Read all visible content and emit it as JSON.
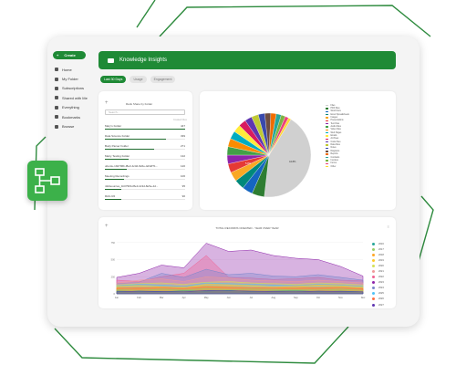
{
  "sidebar": {
    "create_label": "Create",
    "items": [
      {
        "label": "Home",
        "icon": "home-icon"
      },
      {
        "label": "My Folder",
        "icon": "folder-icon"
      },
      {
        "label": "Subscriptions",
        "icon": "bell-icon"
      },
      {
        "label": "Shared with Me",
        "icon": "share-icon"
      },
      {
        "label": "Everything",
        "icon": "layers-icon"
      },
      {
        "label": "Bookmarks",
        "icon": "bookmark-icon"
      },
      {
        "label": "Browse",
        "icon": "browse-icon"
      }
    ]
  },
  "header": {
    "title": "Knowledge Insights"
  },
  "tabs": [
    {
      "label": "Last 30 Days",
      "active": true
    },
    {
      "label": "Usage",
      "active": false
    },
    {
      "label": "Engagement",
      "active": false
    }
  ],
  "folders_card": {
    "title": "Rank Share by Folder",
    "search_placeholder": "Search...",
    "column_label": "Created Files",
    "rows": [
      {
        "name": "Mary's Folder",
        "count": "447",
        "fraction": 1.0
      },
      {
        "name": "Data Science Folder",
        "count": "339",
        "fraction": 0.76
      },
      {
        "name": "Body Parser Folder",
        "count": "271",
        "fraction": 0.61
      },
      {
        "name": "Marty Testing Folder",
        "count": "132",
        "fraction": 0.3
      },
      {
        "name": "ubuntu-1b0796b-f8e3-4c3d-8e5e-4d32f71...",
        "count": "120",
        "fraction": 0.27
      },
      {
        "name": "Meeting Recordings",
        "count": "106",
        "fraction": 0.24
      },
      {
        "name": "ntkbsources_1b0796b-f8e3-4c3d-8e5e-4d...",
        "count": "95",
        "fraction": 0.21
      },
      {
        "name": "RAG R2",
        "count": "90",
        "fraction": 0.2
      }
    ]
  },
  "pie_card": {
    "slice_labels": [
      "44.8%",
      "5.0%"
    ],
    "legend": [
      {
        "label": "Files",
        "color": "#d0d0d0"
      },
      {
        "label": "PDF Files",
        "color": "#2e7d32"
      },
      {
        "label": "Word Docs",
        "color": "#1565c0"
      },
      {
        "label": "Excel Spreadsheets",
        "color": "#00897b"
      },
      {
        "label": "Images",
        "color": "#f9a825"
      },
      {
        "label": "Presentations",
        "color": "#e53935"
      },
      {
        "label": "Text Files",
        "color": "#8e24aa"
      },
      {
        "label": "Audio Files",
        "color": "#43a047"
      },
      {
        "label": "Video Files",
        "color": "#fb8c00"
      },
      {
        "label": "Web Pages",
        "color": "#00acc1"
      },
      {
        "label": "Emails",
        "color": "#ffeb3b"
      },
      {
        "label": "Archives",
        "color": "#d81b60"
      },
      {
        "label": "Code Files",
        "color": "#5e35b1"
      },
      {
        "label": "Data Files",
        "color": "#c0ca33"
      },
      {
        "label": "Notes",
        "color": "#3949ab"
      },
      {
        "label": "Diagrams",
        "color": "#6d4c41"
      },
      {
        "label": "Reports",
        "color": "#ef6c00"
      },
      {
        "label": "Contracts",
        "color": "#26a69a"
      },
      {
        "label": "Invoices",
        "color": "#7cb342"
      },
      {
        "label": "Forms",
        "color": "#ec407a"
      },
      {
        "label": "Other",
        "color": "#fdd835"
      }
    ]
  },
  "chart_data": [
    {
      "type": "pie",
      "values": [
        44.8,
        5.0,
        4.2,
        4.0,
        3.8,
        3.6,
        3.5,
        3.4,
        3.3,
        3.2,
        3.1,
        3.0,
        2.9,
        2.8,
        2.6,
        2.4,
        2.2,
        2.0,
        1.7,
        1.4,
        1.1
      ],
      "colors": [
        "#d0d0d0",
        "#2e7d32",
        "#1565c0",
        "#00897b",
        "#f9a825",
        "#e53935",
        "#8e24aa",
        "#43a047",
        "#fb8c00",
        "#00acc1",
        "#ffeb3b",
        "#d81b60",
        "#5e35b1",
        "#c0ca33",
        "#3949ab",
        "#6d4c41",
        "#ef6c00",
        "#26a69a",
        "#7cb342",
        "#ec407a",
        "#fdd835"
      ]
    },
    {
      "type": "area",
      "title": "TOTAL RECORDS CREATED - YEAR OVER YEAR",
      "categories": [
        "Jan",
        "Feb",
        "Mar",
        "Apr",
        "May",
        "Jun",
        "Jul",
        "Aug",
        "Sep",
        "Oct",
        "Nov",
        "Dec"
      ],
      "y_ticks": [
        "0",
        "250",
        "500",
        "750"
      ],
      "ylim": [
        0,
        800
      ],
      "series": [
        {
          "name": "2016",
          "color": "#26a69a",
          "values": [
            40,
            35,
            30,
            45,
            40,
            50,
            35,
            40,
            45,
            35,
            40,
            30
          ]
        },
        {
          "name": "2017",
          "color": "#9ccc65",
          "values": [
            60,
            50,
            70,
            55,
            80,
            60,
            70,
            65,
            60,
            55,
            70,
            50
          ]
        },
        {
          "name": "2018",
          "color": "#ffa726",
          "values": [
            90,
            80,
            100,
            95,
            110,
            100,
            90,
            85,
            95,
            90,
            100,
            80
          ]
        },
        {
          "name": "2019",
          "color": "#ffca28",
          "values": [
            110,
            120,
            100,
            90,
            140,
            130,
            120,
            100,
            110,
            130,
            120,
            100
          ]
        },
        {
          "name": "2020",
          "color": "#d4e157",
          "values": [
            130,
            150,
            160,
            140,
            170,
            180,
            160,
            150,
            140,
            160,
            150,
            130
          ]
        },
        {
          "name": "2021",
          "color": "#ef9a9a",
          "values": [
            160,
            200,
            220,
            180,
            250,
            230,
            200,
            190,
            180,
            200,
            180,
            160
          ]
        },
        {
          "name": "2022",
          "color": "#f06292",
          "values": [
            200,
            180,
            250,
            300,
            560,
            240,
            230,
            210,
            220,
            240,
            200,
            190
          ]
        },
        {
          "name": "2023",
          "color": "#8e24aa",
          "values": [
            240,
            300,
            420,
            380,
            740,
            620,
            640,
            560,
            520,
            500,
            400,
            260
          ]
        },
        {
          "name": "2024",
          "color": "#7986cb",
          "values": [
            150,
            170,
            300,
            240,
            360,
            280,
            300,
            260,
            250,
            280,
            240,
            200
          ]
        },
        {
          "name": "2025",
          "color": "#4fc3f7",
          "values": [
            120,
            140,
            130,
            110,
            160,
            150,
            140,
            130,
            120,
            140,
            130,
            110
          ]
        },
        {
          "name": "2026",
          "color": "#ff7043",
          "values": [
            80,
            90,
            85,
            75,
            100,
            95,
            90,
            85,
            80,
            90,
            85,
            75
          ]
        },
        {
          "name": "2027",
          "color": "#5e35b1",
          "values": [
            30,
            40,
            35,
            30,
            50,
            45,
            40,
            35,
            30,
            40,
            35,
            30
          ]
        }
      ]
    }
  ]
}
